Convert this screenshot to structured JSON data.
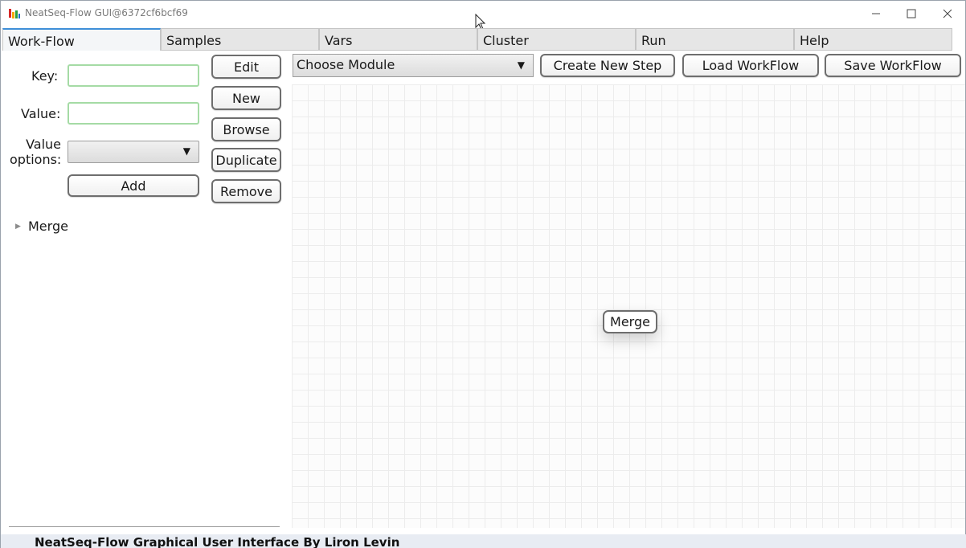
{
  "window": {
    "title": "NeatSeq-Flow GUI@6372cf6bcf69",
    "icons": {
      "app": "neatseq-app-icon",
      "minimize": "minimize-icon",
      "maximize": "maximize-icon",
      "close": "close-icon"
    }
  },
  "tabs": [
    {
      "label": "Work-Flow",
      "active": true
    },
    {
      "label": "Samples",
      "active": false
    },
    {
      "label": "Vars",
      "active": false
    },
    {
      "label": "Cluster",
      "active": false
    },
    {
      "label": "Run",
      "active": false
    },
    {
      "label": "Help",
      "active": false
    }
  ],
  "editor": {
    "key_label": "Key:",
    "key_value": "",
    "value_label": "Value:",
    "value_value": "",
    "value_options_label_1": "Value",
    "value_options_label_2": "options:",
    "value_options_selected": "",
    "add_label": "Add"
  },
  "side_buttons": {
    "edit": "Edit",
    "new": "New",
    "browse": "Browse",
    "duplicate": "Duplicate",
    "remove": "Remove"
  },
  "tree": {
    "items": [
      {
        "label": "Merge",
        "expanded": false
      }
    ]
  },
  "toolbar": {
    "module_select": "Choose Module",
    "create_step": "Create New Step",
    "load_workflow": "Load WorkFlow",
    "save_workflow": "Save WorkFlow"
  },
  "canvas": {
    "nodes": [
      {
        "label": "Merge"
      }
    ]
  },
  "status": {
    "text": "NeatSeq-Flow Graphical User Interface By Liron Levin"
  },
  "colors": {
    "active_tab_accent": "#3f8fd8",
    "field_border": "#a5dba5",
    "status_bg": "#e8ecf3"
  }
}
